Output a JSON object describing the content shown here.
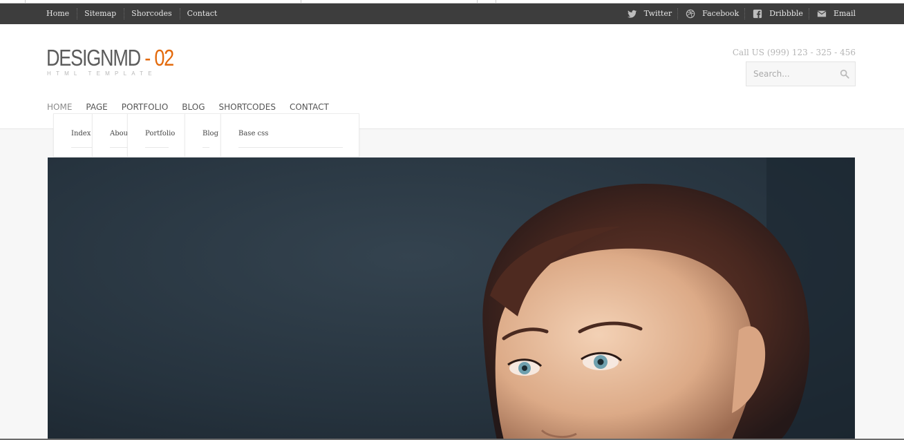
{
  "topbar": {
    "links": [
      "Home",
      "Sitemap",
      "Shorcodes",
      "Contact"
    ],
    "social": [
      {
        "label": "Twitter",
        "icon": "twitter-icon"
      },
      {
        "label": "Facebook",
        "icon": "dribbble-ball-icon"
      },
      {
        "label": "Dribbble",
        "icon": "facebook-icon"
      },
      {
        "label": "Email",
        "icon": "email-icon"
      }
    ]
  },
  "logo": {
    "name": "DESIGNMD",
    "dash": "-",
    "number": "02",
    "tagline": "HTML  TEMPLATE"
  },
  "callus": "Call US (999) 123 - 325 - 456",
  "search": {
    "placeholder": "Search..."
  },
  "nav": {
    "items": [
      "HOME",
      "PAGE",
      "PORTFOLIO",
      "BLOG",
      "SHORTCODES",
      "CONTACT"
    ]
  },
  "dropdowns": [
    "Index",
    "About",
    "Portfolio",
    "Blog",
    "Base css"
  ],
  "colors": {
    "accent": "#e36a0c",
    "topbar": "#3d3d3d",
    "slider_bg": "#253340"
  }
}
